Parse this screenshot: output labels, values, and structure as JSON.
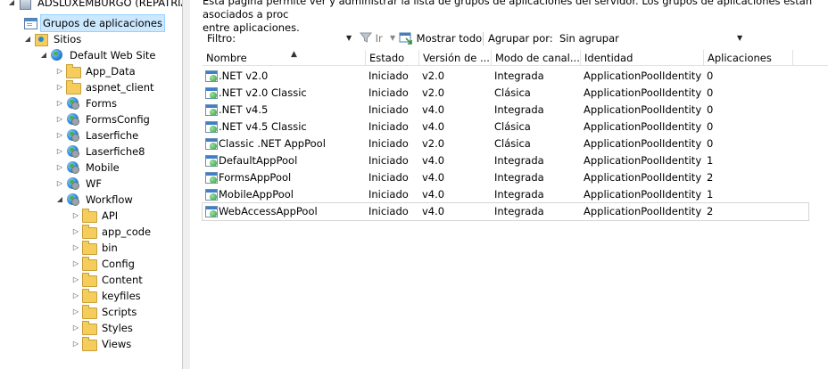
{
  "tree": {
    "server": "ADSLUXEMBURGO (REPATRIAV",
    "app_pools": "Grupos de aplicaciones",
    "sites": "Sitios",
    "default_site": "Default Web Site",
    "children": [
      "App_Data",
      "aspnet_client",
      "Forms",
      "FormsConfig",
      "Laserfiche",
      "Laserfiche8",
      "Mobile",
      "WF",
      "Workflow"
    ],
    "workflow_children": [
      "API",
      "app_code",
      "bin",
      "Config",
      "Content",
      "keyfiles",
      "Scripts",
      "Styles",
      "Views"
    ]
  },
  "content": {
    "description_line1": "Esta página permite ver y administrar la lista de grupos de aplicaciones del servidor. Los grupos de aplicaciones están asociados a proc",
    "description_line2": "entre aplicaciones."
  },
  "filterbar": {
    "filter_label": "Filtro:",
    "go_label": "Ir",
    "show_all_label": "Mostrar todo",
    "group_by_label": "Agrupar por:",
    "group_by_value": "Sin agrupar"
  },
  "grid": {
    "columns": [
      "Nombre",
      "Estado",
      "Versión de ...",
      "Modo de canal...",
      "Identidad",
      "Aplicaciones"
    ],
    "rows": [
      [
        ".NET v2.0",
        "Iniciado",
        "v2.0",
        "Integrada",
        "ApplicationPoolIdentity",
        "0"
      ],
      [
        ".NET v2.0 Classic",
        "Iniciado",
        "v2.0",
        "Clásica",
        "ApplicationPoolIdentity",
        "0"
      ],
      [
        ".NET v4.5",
        "Iniciado",
        "v4.0",
        "Integrada",
        "ApplicationPoolIdentity",
        "0"
      ],
      [
        ".NET v4.5 Classic",
        "Iniciado",
        "v4.0",
        "Clásica",
        "ApplicationPoolIdentity",
        "0"
      ],
      [
        "Classic .NET AppPool",
        "Iniciado",
        "v2.0",
        "Clásica",
        "ApplicationPoolIdentity",
        "0"
      ],
      [
        "DefaultAppPool",
        "Iniciado",
        "v4.0",
        "Integrada",
        "ApplicationPoolIdentity",
        "1"
      ],
      [
        "FormsAppPool",
        "Iniciado",
        "v4.0",
        "Integrada",
        "ApplicationPoolIdentity",
        "2"
      ],
      [
        "MobileAppPool",
        "Iniciado",
        "v4.0",
        "Integrada",
        "ApplicationPoolIdentity",
        "1"
      ],
      [
        "WebAccessAppPool",
        "Iniciado",
        "v4.0",
        "Integrada",
        "ApplicationPoolIdentity",
        "2"
      ]
    ],
    "selected_row": 8
  },
  "colors": {
    "selection": "#cce8ff",
    "folder": "#f5cd5c"
  }
}
